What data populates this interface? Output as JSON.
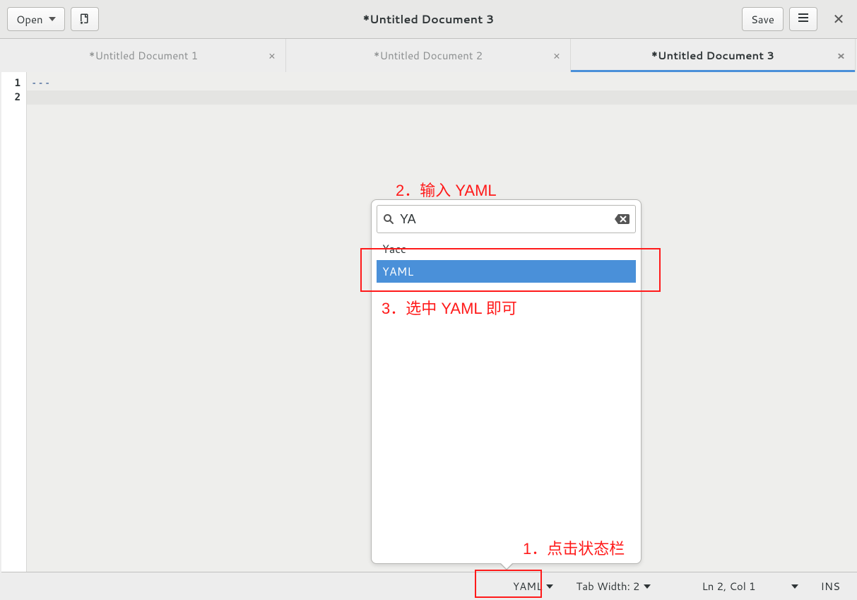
{
  "toolbar": {
    "open_label": "Open",
    "save_label": "Save",
    "title": "*Untitled Document 3"
  },
  "tabs": [
    {
      "label": "*Untitled Document 1",
      "active": false
    },
    {
      "label": "*Untitled Document 2",
      "active": false
    },
    {
      "label": "*Untitled Document 3",
      "active": true
    }
  ],
  "editor": {
    "lines": [
      {
        "num": "1",
        "content": "---",
        "class": "yaml-dash"
      },
      {
        "num": "2",
        "content": "",
        "current": true
      }
    ]
  },
  "popover": {
    "search_value": "YA",
    "items": [
      {
        "label": "Yacc",
        "hl": false
      },
      {
        "label": "YAML",
        "hl": true
      }
    ]
  },
  "statusbar": {
    "language": "YAML",
    "tabwidth": "Tab Width: 2",
    "position": "Ln 2, Col 1",
    "mode": "INS"
  },
  "annotations": {
    "a1": "1．点击状态栏",
    "a2": "2．输入 YAML",
    "a3": "3．选中 YAML 即可"
  }
}
